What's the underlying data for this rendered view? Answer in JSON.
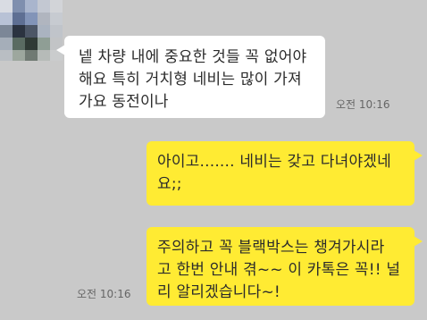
{
  "chat": {
    "messages": [
      {
        "direction": "incoming",
        "text": "넽 차량 내에 중요한 것들 꼭 없어야\n해요 특히 거치형 네비는 많이 가져\n가요 동전이나",
        "time": "오전 10:16"
      },
      {
        "direction": "outgoing",
        "text": "아이고....... 네비는 갖고 다녀야겠네\n요;;"
      },
      {
        "direction": "outgoing",
        "text": "주의하고 꼭 블랙박스는 챙겨가시라\n고 한번 안내 겪~~ 이 카톡은 꼭!! 널\n리 알리겠습니다~!",
        "time": "오전 10:16"
      }
    ]
  },
  "colors": {
    "background": "#c9c9c9",
    "incoming_bubble": "#ffffff",
    "outgoing_bubble": "#ffeb33"
  },
  "icons": {
    "avatar": "blurred-profile-avatar"
  }
}
